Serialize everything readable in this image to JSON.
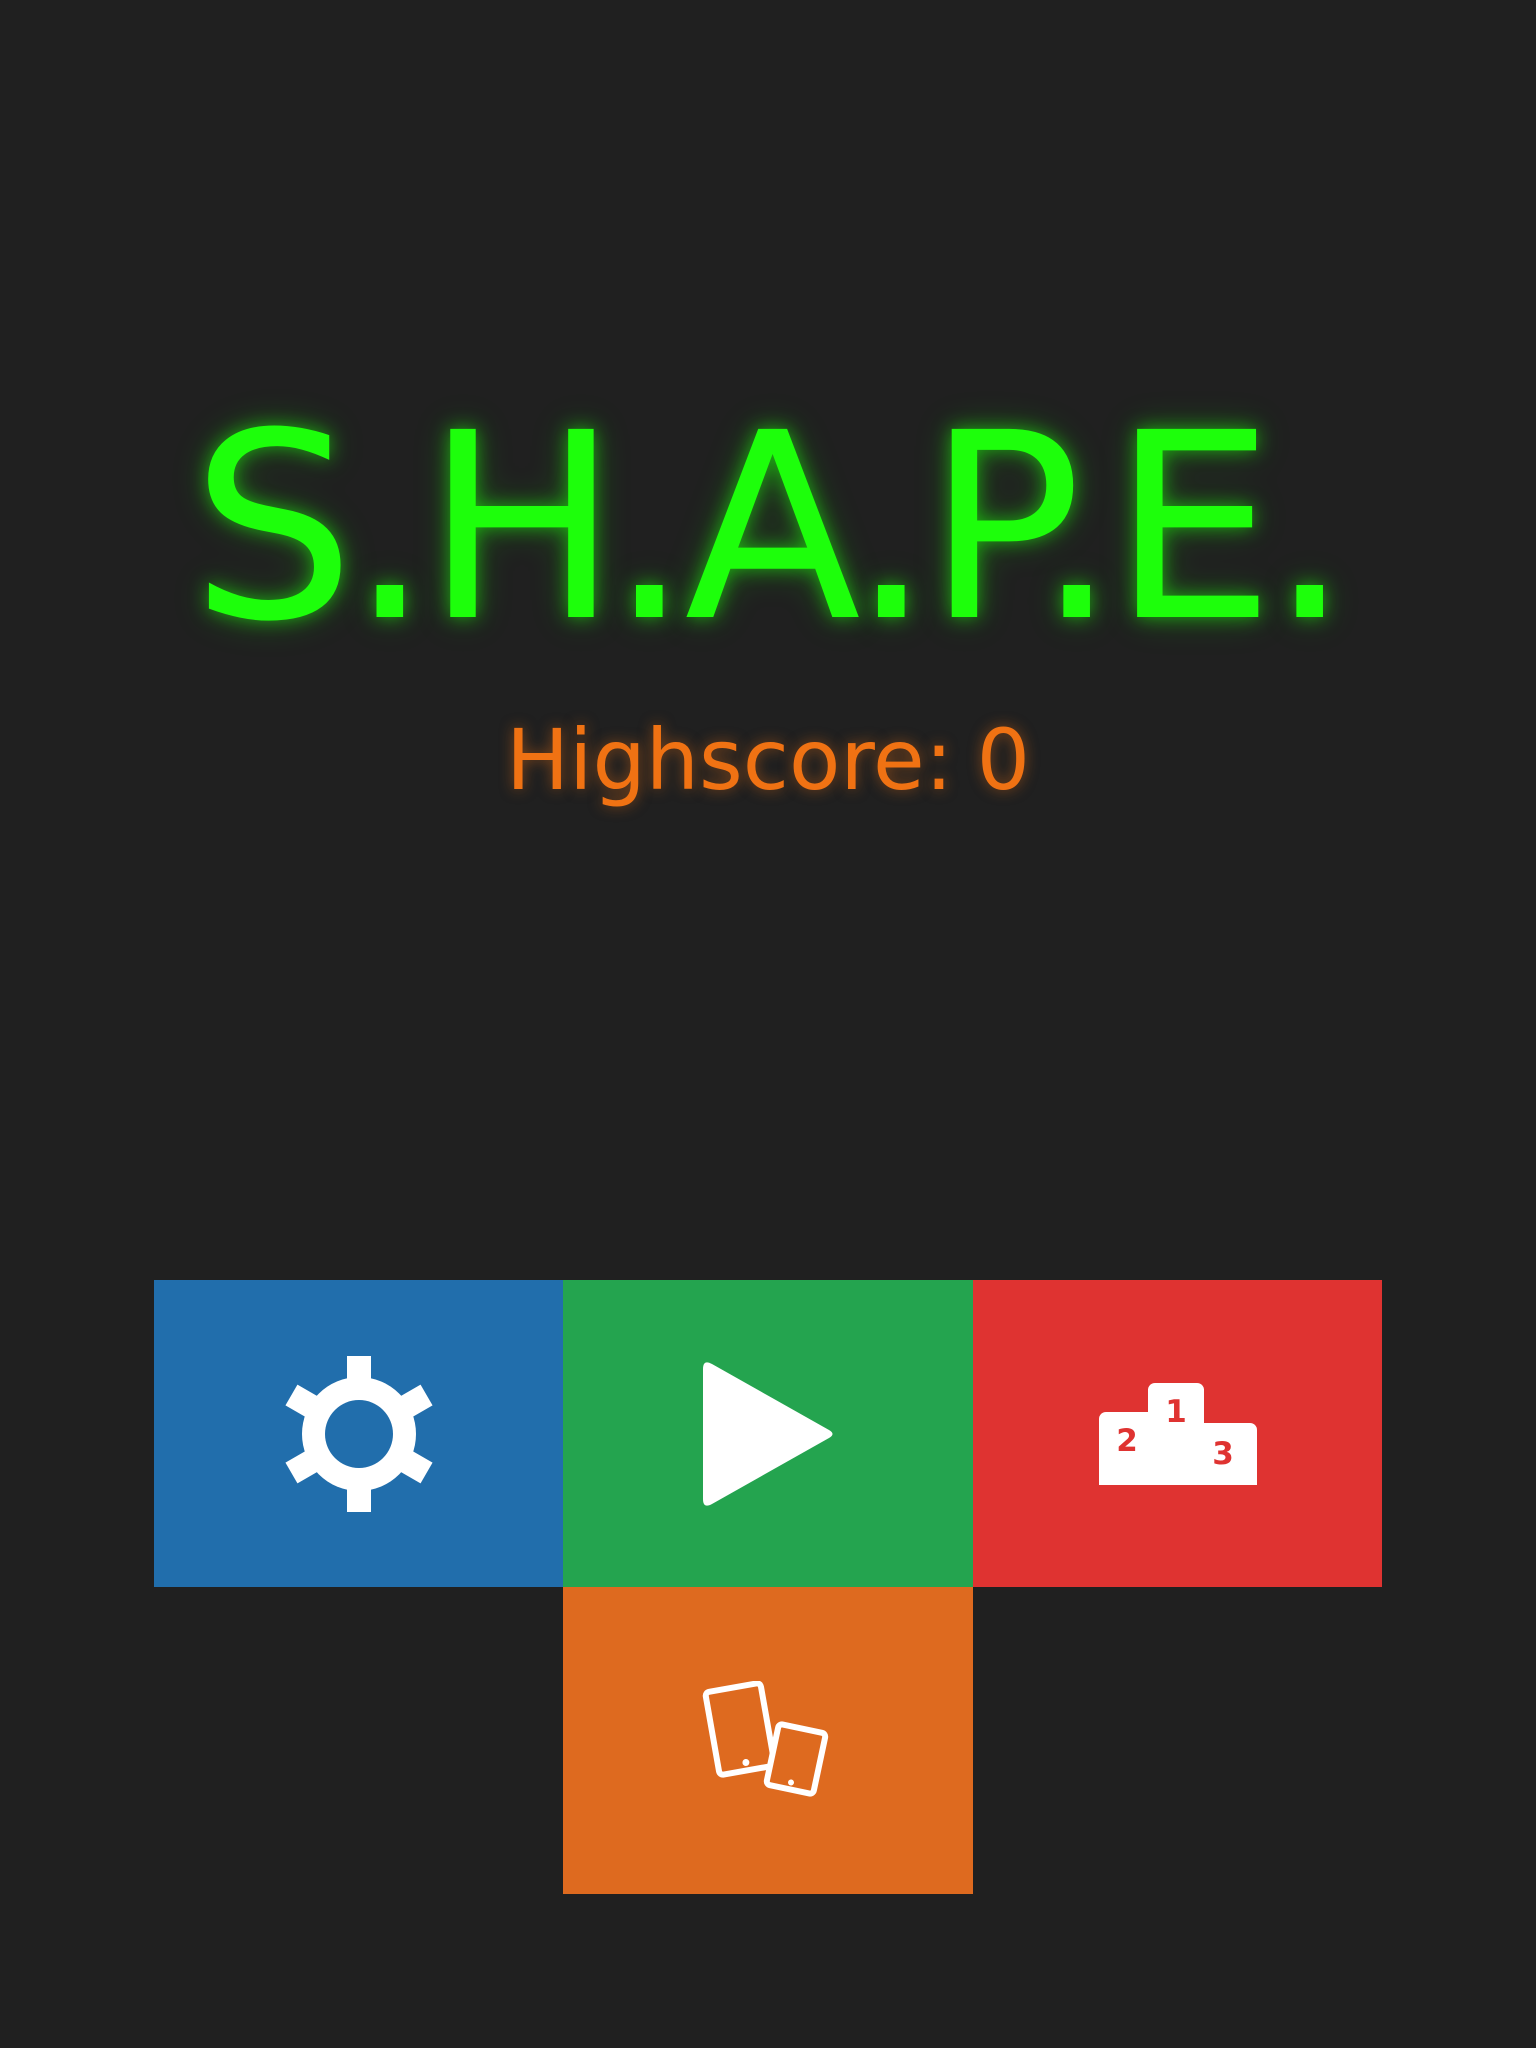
{
  "title": "S.H.A.P.E.",
  "highscore": {
    "label": "Highscore:",
    "value": "0"
  },
  "tiles": [
    {
      "name": "settings",
      "icon": "gear-icon",
      "color": "#216eac"
    },
    {
      "name": "play",
      "icon": "play-icon",
      "color": "#24a44f"
    },
    {
      "name": "leaderboard",
      "icon": "podium-icon",
      "color": "#df3331",
      "podium_labels": {
        "first": "1",
        "second": "2",
        "third": "3"
      }
    },
    {
      "name": "devices",
      "icon": "tablets-icon",
      "color": "#de6a1f"
    }
  ],
  "colors": {
    "background": "#202020",
    "title": "#1dff0b",
    "highscore": "#f07213",
    "icon": "#ffffff"
  }
}
